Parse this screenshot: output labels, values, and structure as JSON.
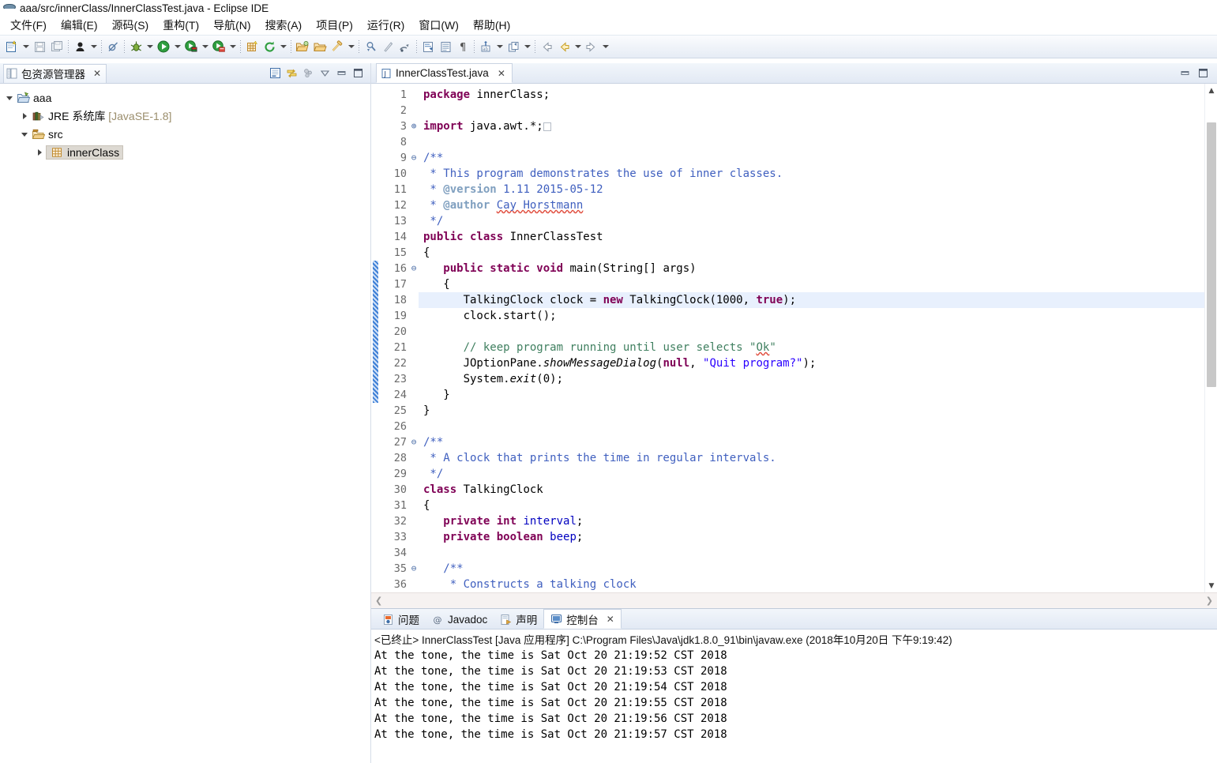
{
  "window": {
    "title": "aaa/src/innerClass/InnerClassTest.java - Eclipse IDE",
    "icon": "eclipse-icon"
  },
  "menubar": {
    "items": [
      {
        "label": "文件(F)",
        "name": "menu-file"
      },
      {
        "label": "编辑(E)",
        "name": "menu-edit"
      },
      {
        "label": "源码(S)",
        "name": "menu-source"
      },
      {
        "label": "重构(T)",
        "name": "menu-refactor"
      },
      {
        "label": "导航(N)",
        "name": "menu-navigate"
      },
      {
        "label": "搜索(A)",
        "name": "menu-search"
      },
      {
        "label": "项目(P)",
        "name": "menu-project"
      },
      {
        "label": "运行(R)",
        "name": "menu-run"
      },
      {
        "label": "窗口(W)",
        "name": "menu-window"
      },
      {
        "label": "帮助(H)",
        "name": "menu-help"
      }
    ]
  },
  "toolbar": {
    "groups": [
      [
        "new-wizard-icon",
        "dropdown",
        "save-icon",
        "save-all-icon"
      ],
      [
        "person-icon",
        "dropdown"
      ],
      [
        "skip-breakpoints-icon"
      ],
      [
        "debug-icon",
        "dropdown"
      ],
      [
        "run-icon",
        "dropdown"
      ],
      [
        "run-external-tools-icon",
        "dropdown"
      ],
      [
        "run-last-tool-icon",
        "dropdown"
      ],
      [
        "new-package-icon",
        "refresh-icon",
        "dropdown"
      ],
      [
        "open-type-icon",
        "open-task-icon",
        "search-icon",
        "dropdown"
      ],
      [
        "next-annotation-icon",
        "previous-annotation-icon",
        "last-edit-icon"
      ],
      [
        "toggle-mark-occurrences-icon",
        "show-whitespace-icon",
        "toggle-block-selection-icon",
        "pilcrow-icon"
      ],
      [
        "link-icon",
        "dropdown"
      ],
      [
        "restore-icon",
        "dropdown"
      ],
      [
        "back-icon",
        "back-yellow-icon",
        "dropdown",
        "forward-icon",
        "dropdown"
      ]
    ]
  },
  "package_explorer": {
    "tab_label": "包资源管理器",
    "tab_icon": "package-explorer-icon",
    "close_label": "✕",
    "actions": [
      {
        "name": "collapse-all-icon",
        "title": "全部折叠"
      },
      {
        "name": "link-with-editor-icon",
        "title": "与编辑器链接"
      },
      {
        "name": "focus-on-active-task-icon",
        "title": "聚焦活动任务"
      },
      {
        "name": "view-menu-icon",
        "title": "视图菜单"
      },
      {
        "name": "minimize-icon",
        "title": "最小化"
      },
      {
        "name": "maximize-icon",
        "title": "最大化"
      }
    ],
    "tree": [
      {
        "label": "aaa",
        "icon": "java-project-icon",
        "expanded": true,
        "indent": 0,
        "selected": false,
        "suffix": ""
      },
      {
        "label": "JRE 系统库",
        "icon": "jre-library-icon",
        "expanded": false,
        "indent": 1,
        "selected": false,
        "suffix": "[JavaSE-1.8]"
      },
      {
        "label": "src",
        "icon": "source-folder-icon",
        "expanded": true,
        "indent": 1,
        "selected": false,
        "suffix": ""
      },
      {
        "label": "innerClass",
        "icon": "package-icon",
        "expanded": false,
        "indent": 2,
        "selected": true,
        "suffix": ""
      }
    ]
  },
  "editor": {
    "tab_label": "InnerClassTest.java",
    "tab_icon": "java-file-icon",
    "close_label": "✕",
    "actions": [
      {
        "name": "minimize-icon"
      },
      {
        "name": "maximize-icon"
      }
    ],
    "highlight_line": 18,
    "scroll": {
      "vertical_thumb_top_pct": 5,
      "vertical_thumb_height_pct": 52,
      "up_arrow": "▲",
      "down_arrow": "▼",
      "left_arrow": "❮",
      "right_arrow": "❯"
    },
    "lines": [
      {
        "no": "1",
        "fold": "",
        "segs": [
          {
            "t": "package",
            "c": "kw"
          },
          {
            "t": " innerClass;",
            "c": ""
          }
        ]
      },
      {
        "no": "2",
        "fold": "",
        "segs": []
      },
      {
        "no": "3",
        "fold": "⊕",
        "segs": [
          {
            "t": "import",
            "c": "kw"
          },
          {
            "t": " java.awt.*;",
            "c": ""
          },
          {
            "t": "▯",
            "c": "folded"
          }
        ]
      },
      {
        "no": "8",
        "fold": "",
        "segs": []
      },
      {
        "no": "9",
        "fold": "⊖",
        "segs": [
          {
            "t": "/**",
            "c": "doc"
          }
        ]
      },
      {
        "no": "10",
        "fold": "",
        "segs": [
          {
            "t": " * This program demonstrates the use of inner classes.",
            "c": "doc"
          }
        ]
      },
      {
        "no": "11",
        "fold": "",
        "segs": [
          {
            "t": " * ",
            "c": "doc"
          },
          {
            "t": "@version",
            "c": "doctag"
          },
          {
            "t": " 1.11 2015-05-12",
            "c": "doc"
          }
        ]
      },
      {
        "no": "12",
        "fold": "",
        "segs": [
          {
            "t": " * ",
            "c": "doc"
          },
          {
            "t": "@author",
            "c": "doctag"
          },
          {
            "t": " ",
            "c": "doc"
          },
          {
            "t": "Cay Horstmann",
            "c": "doc spell"
          }
        ]
      },
      {
        "no": "13",
        "fold": "",
        "segs": [
          {
            "t": " */",
            "c": "doc"
          }
        ]
      },
      {
        "no": "14",
        "fold": "",
        "segs": [
          {
            "t": "public class",
            "c": "kw"
          },
          {
            "t": " InnerClassTest",
            "c": ""
          }
        ]
      },
      {
        "no": "15",
        "fold": "",
        "segs": [
          {
            "t": "{",
            "c": ""
          }
        ]
      },
      {
        "no": "16",
        "fold": "⊖",
        "segs": [
          {
            "t": "   ",
            "c": ""
          },
          {
            "t": "public static void",
            "c": "kw"
          },
          {
            "t": " main(String[] args)",
            "c": ""
          }
        ]
      },
      {
        "no": "17",
        "fold": "",
        "segs": [
          {
            "t": "   {",
            "c": ""
          }
        ]
      },
      {
        "no": "18",
        "fold": "",
        "segs": [
          {
            "t": "      TalkingClock clock = ",
            "c": ""
          },
          {
            "t": "new",
            "c": "kw"
          },
          {
            "t": " TalkingClock(1000, ",
            "c": ""
          },
          {
            "t": "true",
            "c": "kw"
          },
          {
            "t": ");",
            "c": ""
          }
        ]
      },
      {
        "no": "19",
        "fold": "",
        "segs": [
          {
            "t": "      clock.start();",
            "c": ""
          }
        ]
      },
      {
        "no": "20",
        "fold": "",
        "segs": []
      },
      {
        "no": "21",
        "fold": "",
        "segs": [
          {
            "t": "      ",
            "c": ""
          },
          {
            "t": "// keep program running until user selects \"",
            "c": "cmt"
          },
          {
            "t": "Ok",
            "c": "cmt spell"
          },
          {
            "t": "\"",
            "c": "cmt"
          }
        ]
      },
      {
        "no": "22",
        "fold": "",
        "segs": [
          {
            "t": "      JOptionPane.",
            "c": ""
          },
          {
            "t": "showMessageDialog",
            "c": "mth"
          },
          {
            "t": "(",
            "c": ""
          },
          {
            "t": "null",
            "c": "kw"
          },
          {
            "t": ", ",
            "c": ""
          },
          {
            "t": "\"Quit program?\"",
            "c": "str"
          },
          {
            "t": ");",
            "c": ""
          }
        ]
      },
      {
        "no": "23",
        "fold": "",
        "segs": [
          {
            "t": "      System.",
            "c": ""
          },
          {
            "t": "exit",
            "c": "mth"
          },
          {
            "t": "(0);",
            "c": ""
          }
        ]
      },
      {
        "no": "24",
        "fold": "",
        "segs": [
          {
            "t": "   }",
            "c": ""
          }
        ]
      },
      {
        "no": "25",
        "fold": "",
        "segs": [
          {
            "t": "}",
            "c": ""
          }
        ]
      },
      {
        "no": "26",
        "fold": "",
        "segs": []
      },
      {
        "no": "27",
        "fold": "⊖",
        "segs": [
          {
            "t": "/**",
            "c": "doc"
          }
        ]
      },
      {
        "no": "28",
        "fold": "",
        "segs": [
          {
            "t": " * A clock that prints the time in regular intervals.",
            "c": "doc"
          }
        ]
      },
      {
        "no": "29",
        "fold": "",
        "segs": [
          {
            "t": " */",
            "c": "doc"
          }
        ]
      },
      {
        "no": "30",
        "fold": "",
        "segs": [
          {
            "t": "class",
            "c": "kw"
          },
          {
            "t": " TalkingClock",
            "c": ""
          }
        ]
      },
      {
        "no": "31",
        "fold": "",
        "segs": [
          {
            "t": "{",
            "c": ""
          }
        ]
      },
      {
        "no": "32",
        "fold": "",
        "segs": [
          {
            "t": "   ",
            "c": ""
          },
          {
            "t": "private int",
            "c": "kw"
          },
          {
            "t": " ",
            "c": ""
          },
          {
            "t": "interval",
            "c": "fld"
          },
          {
            "t": ";",
            "c": ""
          }
        ]
      },
      {
        "no": "33",
        "fold": "",
        "segs": [
          {
            "t": "   ",
            "c": ""
          },
          {
            "t": "private boolean",
            "c": "kw"
          },
          {
            "t": " ",
            "c": ""
          },
          {
            "t": "beep",
            "c": "fld"
          },
          {
            "t": ";",
            "c": ""
          }
        ]
      },
      {
        "no": "34",
        "fold": "",
        "segs": []
      },
      {
        "no": "35",
        "fold": "⊖",
        "segs": [
          {
            "t": "   ",
            "c": ""
          },
          {
            "t": "/**",
            "c": "doc"
          }
        ]
      },
      {
        "no": "36",
        "fold": "",
        "segs": [
          {
            "t": "    * Constructs a talking clock",
            "c": "doc"
          }
        ]
      }
    ]
  },
  "console": {
    "tabs": [
      {
        "label": "问题",
        "icon": "problems-icon",
        "active": false,
        "name": "tab-problems"
      },
      {
        "label": "Javadoc",
        "icon": "javadoc-icon",
        "active": false,
        "name": "tab-javadoc"
      },
      {
        "label": "声明",
        "icon": "declaration-icon",
        "active": false,
        "name": "tab-declaration"
      },
      {
        "label": "控制台",
        "icon": "console-icon",
        "active": true,
        "name": "tab-console"
      }
    ],
    "header": "<已终止> InnerClassTest [Java 应用程序] C:\\Program Files\\Java\\jdk1.8.0_91\\bin\\javaw.exe  (2018年10月20日 下午9:19:42)",
    "output": [
      "At the tone, the time is Sat Oct 20 21:19:52 CST 2018",
      "At the tone, the time is Sat Oct 20 21:19:53 CST 2018",
      "At the tone, the time is Sat Oct 20 21:19:54 CST 2018",
      "At the tone, the time is Sat Oct 20 21:19:55 CST 2018",
      "At the tone, the time is Sat Oct 20 21:19:56 CST 2018",
      "At the tone, the time is Sat Oct 20 21:19:57 CST 2018"
    ]
  },
  "colors": {
    "keyword": "#7f0055",
    "string": "#2a00ff",
    "comment": "#3f7f5f",
    "javadoc": "#3f5fbf",
    "field": "#0000c0",
    "selection": "#e8f0fd",
    "tree_selection": "#ddd9d2"
  }
}
